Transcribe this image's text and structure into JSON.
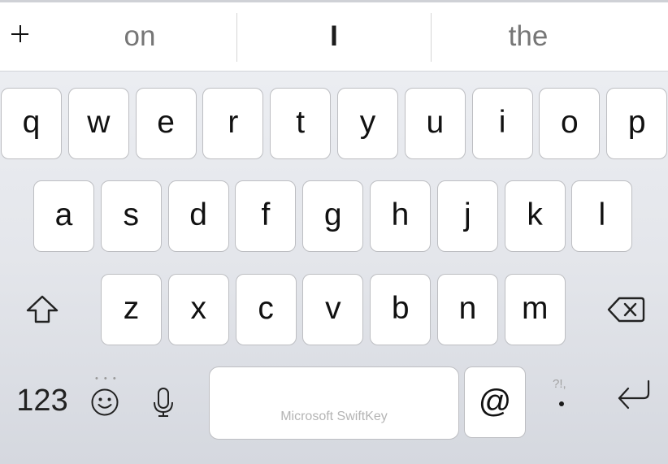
{
  "keyboard": {
    "suggestion_bar": {
      "add_icon": "plus-icon",
      "suggestions": [
        "on",
        "I",
        "the"
      ]
    },
    "rows": [
      [
        "q",
        "w",
        "e",
        "r",
        "t",
        "y",
        "u",
        "i",
        "o",
        "p"
      ],
      [
        "a",
        "s",
        "d",
        "f",
        "g",
        "h",
        "j",
        "k",
        "l"
      ],
      [
        "z",
        "x",
        "c",
        "v",
        "b",
        "n",
        "m"
      ]
    ],
    "shift_icon": "shift-arrow-icon",
    "backspace_icon": "backspace-icon",
    "bottom_row": {
      "numbers_label": "123",
      "emoji_icon": "emoji-smiley-icon",
      "emoji_more_hint": "• • •",
      "mic_icon": "microphone-icon",
      "space_label": "Microsoft SwiftKey",
      "at_label": "@",
      "punctuation_hint": "?!,",
      "period_label": ".",
      "return_icon": "return-arrow-icon"
    }
  }
}
